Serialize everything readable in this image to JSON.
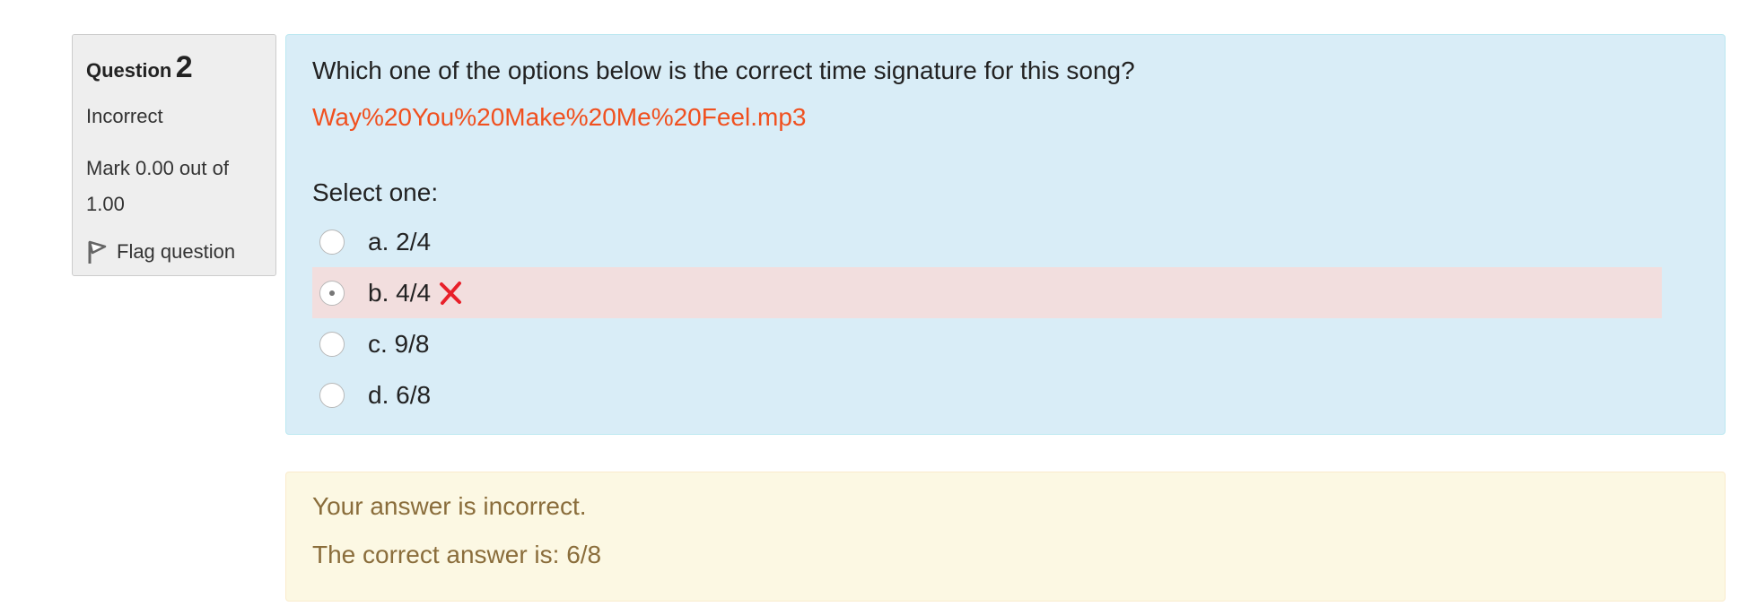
{
  "info": {
    "question_label": "Question",
    "question_number": "2",
    "state": "Incorrect",
    "grade": "Mark 0.00 out of 1.00",
    "flag_label": "Flag question"
  },
  "question": {
    "text": "Which one of the options below is the correct time signature for this song?",
    "audio_link": "Way%20You%20Make%20Me%20Feel.mp3",
    "prompt": "Select one:",
    "options": [
      {
        "label": "a. 2/4",
        "selected": false,
        "marked_incorrect": false
      },
      {
        "label": "b. 4/4",
        "selected": true,
        "marked_incorrect": true
      },
      {
        "label": "c. 9/8",
        "selected": false,
        "marked_incorrect": false
      },
      {
        "label": "d. 6/8",
        "selected": false,
        "marked_incorrect": false
      }
    ]
  },
  "feedback": {
    "result": "Your answer is incorrect.",
    "right_answer": "The correct answer is: 6/8"
  },
  "colors": {
    "question_bg": "#d9edf7",
    "feedback_bg": "#fcf8e3",
    "incorrect_bg": "#f2dede",
    "link": "#f0501f",
    "cross": "#e8202a"
  },
  "icons": [
    "flag-icon",
    "incorrect-cross-icon"
  ]
}
